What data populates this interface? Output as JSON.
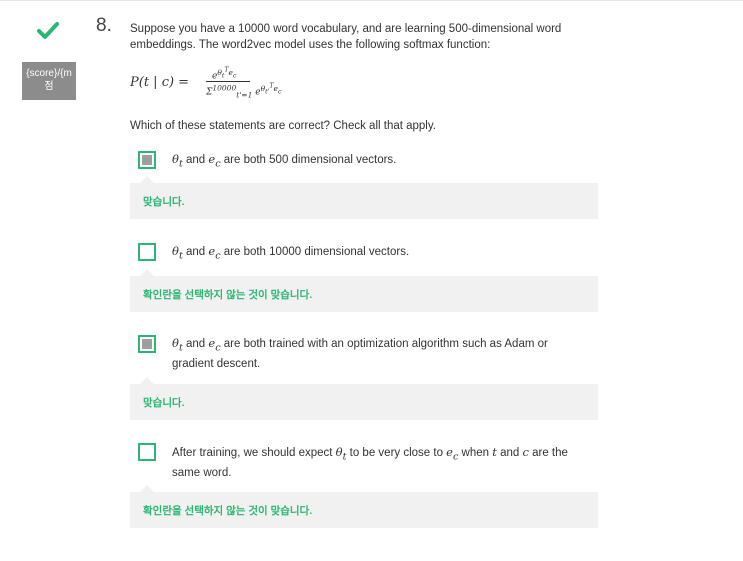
{
  "question": {
    "number": "8.",
    "text": "Suppose you have a 10000 word vocabulary, and are learning 500-dimensional word embeddings. The word2vec model uses the following softmax function:",
    "prompt": "Which of these statements are correct? Check all that apply."
  },
  "score": {
    "line1": "{score}/{m",
    "line2": "점"
  },
  "formula": {
    "lhs": "P(t | c) =",
    "numerator": "e^{θ_t^T e_c}",
    "denominator": "Σ_{t'=1}^{10000} e^{θ_{t'}^T e_c}"
  },
  "options": [
    {
      "checked": true,
      "math1": "θt",
      "mid": " and ",
      "math2": "ec",
      "text": " are both 500 dimensional vectors.",
      "feedback": "맞습니다."
    },
    {
      "checked": false,
      "math1": "θt",
      "mid": " and ",
      "math2": "ec",
      "text": " are both 10000 dimensional vectors.",
      "feedback": "확인란을 선택하지 않는 것이 맞습니다."
    },
    {
      "checked": true,
      "math1": "θt",
      "mid": " and ",
      "math2": "ec",
      "text": " are both trained with an optimization algorithm such as Adam or gradient descent.",
      "feedback": "맞습니다."
    },
    {
      "checked": false,
      "pre": "After training, we should expect ",
      "math1": "θt",
      "mid": " to be very close to ",
      "math2": "ec",
      "mid2": " when ",
      "math3": "t",
      "mid3": " and ",
      "math4": "c",
      "text": " are the same word.",
      "feedback": "확인란을 선택하지 않는 것이 맞습니다."
    }
  ],
  "colors": {
    "correct": "#2bb673",
    "feedback_bg": "#f1f1f1",
    "badge_bg": "#8c8c8c"
  },
  "icons": {
    "status": "check-icon"
  }
}
